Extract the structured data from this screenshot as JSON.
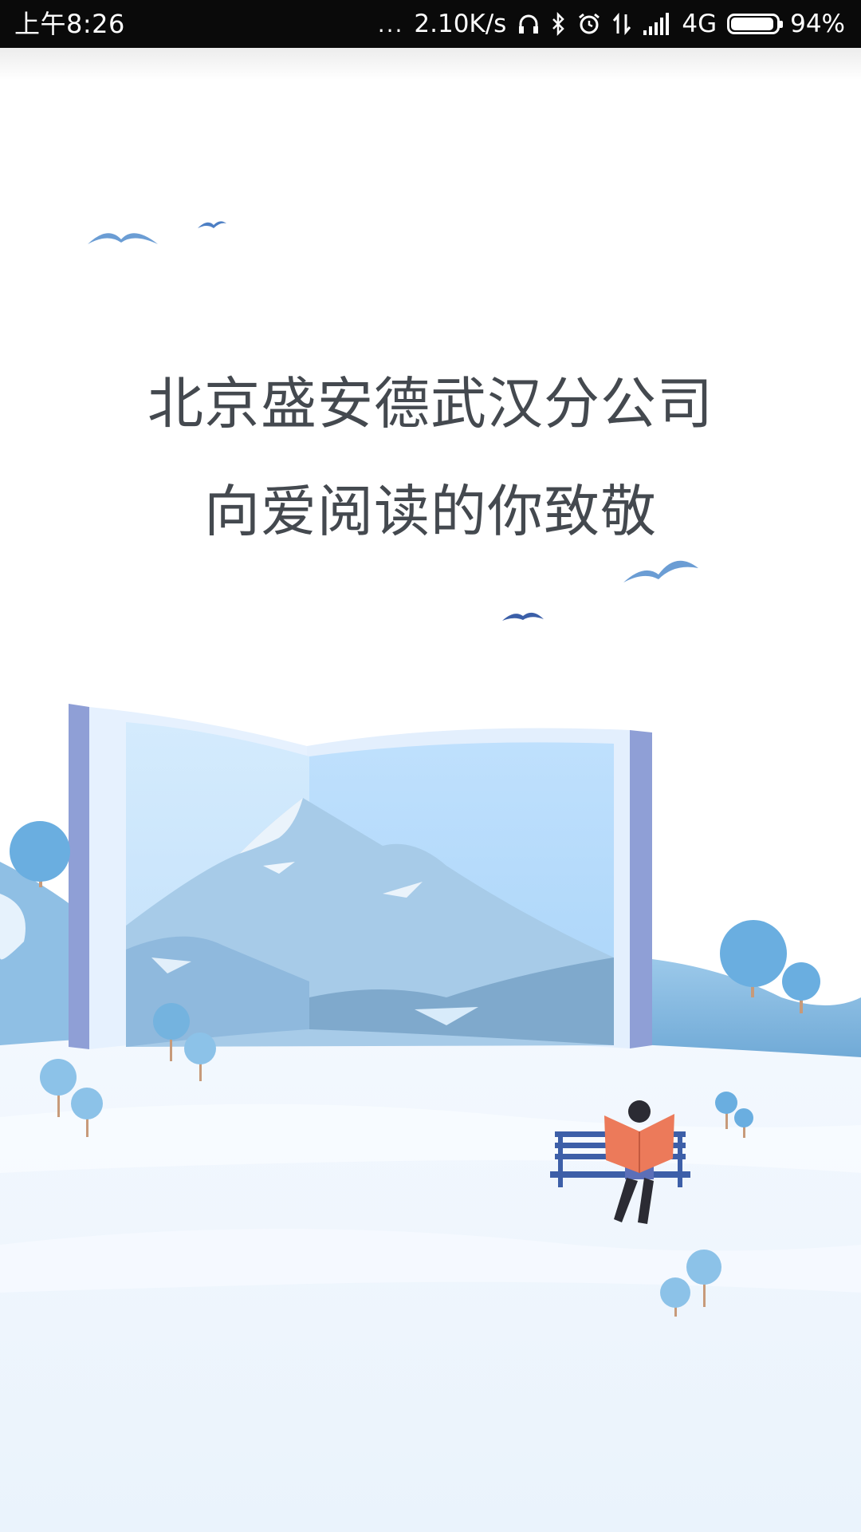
{
  "status_bar": {
    "time": "上午8:26",
    "more": "...",
    "speed": "2.10K/s",
    "network": "4G",
    "battery": "94%",
    "icons": [
      "headphones-icon",
      "bluetooth-icon",
      "alarm-icon",
      "data-transfer-icon",
      "signal-icon",
      "battery-icon"
    ]
  },
  "splash": {
    "title": "北京盛安德武汉分公司",
    "subtitle": "向爱阅读的你致敬"
  },
  "colors": {
    "text": "#44494f",
    "sky_blue": "#b8dcfa",
    "tree_blue": "#6aaee0",
    "snow": "#edf5fd"
  }
}
